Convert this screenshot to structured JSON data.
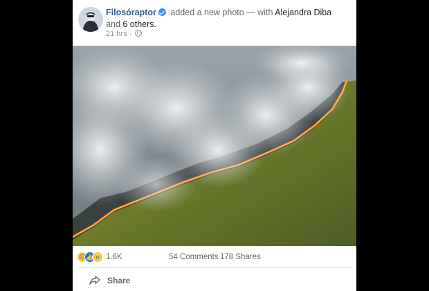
{
  "post": {
    "author": "Filosóraptor",
    "action_text": " added a new photo — with ",
    "tagged": "Alejandra Diba",
    "and_text": " and ",
    "others": "6 others.",
    "time": "21 hrs ·",
    "privacy_icon": "globe-icon"
  },
  "photo": {
    "subject": "aerial view of a forest fire line with smoke",
    "colors": {
      "smoke": "#cfd3d6",
      "fire": "#ff7a1a",
      "forest": "#6f7a2e"
    }
  },
  "stats": {
    "reactions": [
      "sad",
      "like",
      "wow"
    ],
    "reaction_count": "1.6K",
    "comments": "54 Comments",
    "shares": "178 Shares"
  },
  "actions": {
    "share_label": "Share",
    "share_icon": "share-arrow-icon"
  },
  "colors": {
    "link": "#385898",
    "meta": "#90949c",
    "background": "#000000",
    "card": "#ffffff"
  }
}
